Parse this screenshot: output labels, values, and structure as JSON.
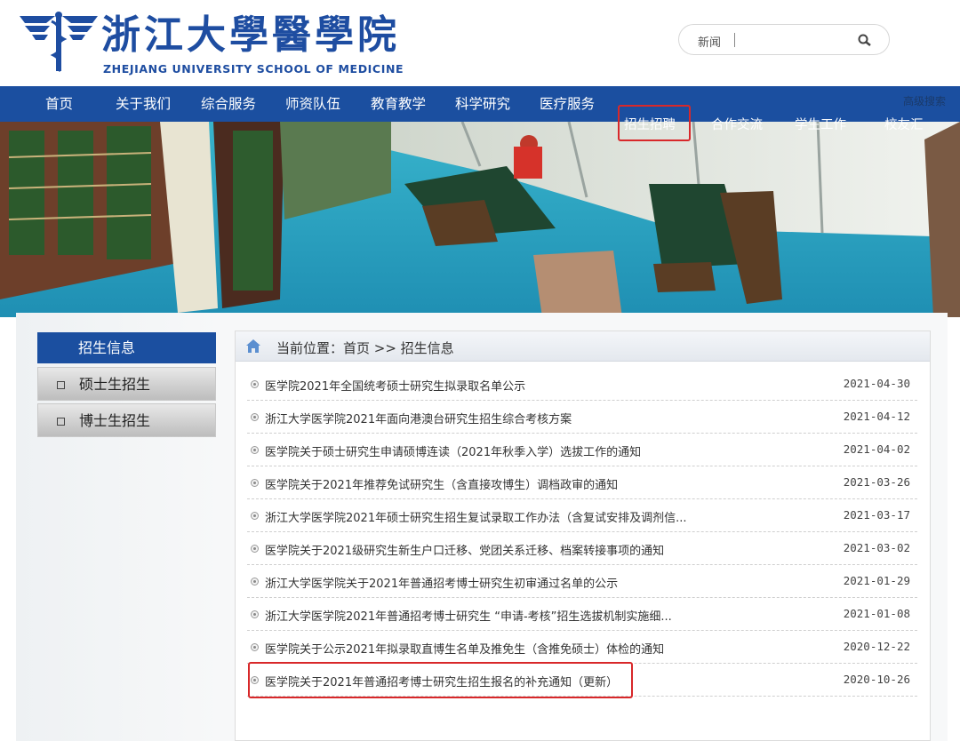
{
  "header": {
    "logo_cn": "浙江大學醫學院",
    "logo_en": "ZHEJIANG UNIVERSITY SCHOOL OF MEDICINE",
    "search": {
      "category": "新闻",
      "placeholder": ""
    },
    "advanced_search": "高级搜索"
  },
  "nav": {
    "items": [
      "首页",
      "关于我们",
      "综合服务",
      "师资队伍",
      "教育教学",
      "科学研究",
      "医疗服务"
    ],
    "overflow_items": [
      "招生招聘",
      "合作交流",
      "学生工作",
      "校友汇"
    ],
    "highlighted": "招生招聘"
  },
  "sidebar": {
    "title": "招生信息",
    "items": [
      "硕士生招生",
      "博士生招生"
    ]
  },
  "breadcrumb": {
    "text": "当前位置：首页 >> 招生信息"
  },
  "news": [
    {
      "title": "医学院2021年全国统考硕士研究生拟录取名单公示",
      "date": "2021-04-30"
    },
    {
      "title": "浙江大学医学院2021年面向港澳台研究生招生综合考核方案",
      "date": "2021-04-12"
    },
    {
      "title": "医学院关于硕士研究生申请硕博连读（2021年秋季入学）选拔工作的通知",
      "date": "2021-04-02"
    },
    {
      "title": "医学院关于2021年推荐免试研究生（含直接攻博生）调档政审的通知",
      "date": "2021-03-26"
    },
    {
      "title": "浙江大学医学院2021年硕士研究生招生复试录取工作办法（含复试安排及调剂信...",
      "date": "2021-03-17"
    },
    {
      "title": "医学院关于2021级研究生新生户口迁移、党团关系迁移、档案转接事项的通知",
      "date": "2021-03-02"
    },
    {
      "title": "浙江大学医学院关于2021年普通招考博士研究生初审通过名单的公示",
      "date": "2021-01-29"
    },
    {
      "title": "浙江大学医学院2021年普通招考博士研究生 “申请-考核”招生选拔机制实施细...",
      "date": "2021-01-08"
    },
    {
      "title": "医学院关于公示2021年拟录取直博生名单及推免生（含推免硕士）体检的通知",
      "date": "2020-12-22"
    },
    {
      "title": "医学院关于2021年普通招考博士研究生招生报名的补充通知（更新）",
      "date": "2020-10-26"
    }
  ],
  "colors": {
    "brand_blue": "#1b4fa0",
    "highlight_red": "#d8282a"
  }
}
